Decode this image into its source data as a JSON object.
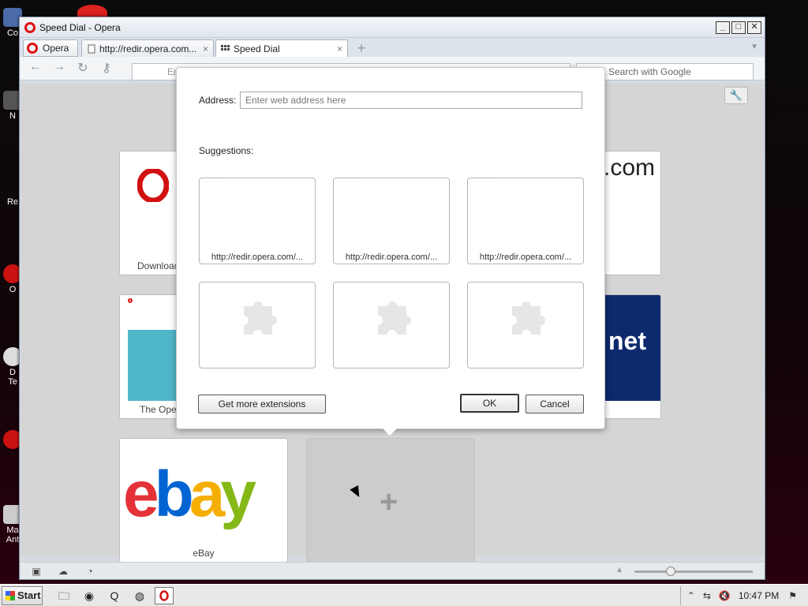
{
  "window": {
    "title": "Speed Dial - Opera"
  },
  "tabs": {
    "menu_label": "Opera",
    "items": [
      {
        "label": "http://redir.opera.com...",
        "close": "×"
      },
      {
        "label": "Speed Dial",
        "close": "×"
      }
    ]
  },
  "toolbar": {
    "address_placeholder": "Ent",
    "search_placeholder": "Search with Google"
  },
  "speed_dial": {
    "tiles": [
      {
        "label": "Download",
        "logo_text": ""
      },
      {
        "label": "",
        "logo_text": ".com"
      },
      {
        "label": "The Oper",
        "logo_text": ""
      },
      {
        "label": "",
        "logo_text": "net"
      },
      {
        "label": "eBay",
        "logo_text": "ebay"
      }
    ]
  },
  "dialog": {
    "address_label": "Address:",
    "address_placeholder": "Enter web address here",
    "suggestions_label": "Suggestions:",
    "suggestions": [
      "http://redir.opera.com/...",
      "http://redir.opera.com/...",
      "http://redir.opera.com/..."
    ],
    "get_more_label": "Get more extensions",
    "ok_label": "OK",
    "cancel_label": "Cancel"
  },
  "taskbar": {
    "start_label": "Start",
    "clock": "10:47 PM"
  },
  "desktop": {
    "labels": [
      "Co",
      "N",
      "Re",
      "O",
      "D",
      "Te",
      "Ma",
      "Ant"
    ]
  },
  "colors": {
    "opera_red": "#d11111",
    "ebay_red": "#e53238",
    "ebay_blue": "#0064d2",
    "ebay_yellow": "#f5af02",
    "ebay_green": "#86b817",
    "cnet_blue": "#0d2a6e"
  }
}
